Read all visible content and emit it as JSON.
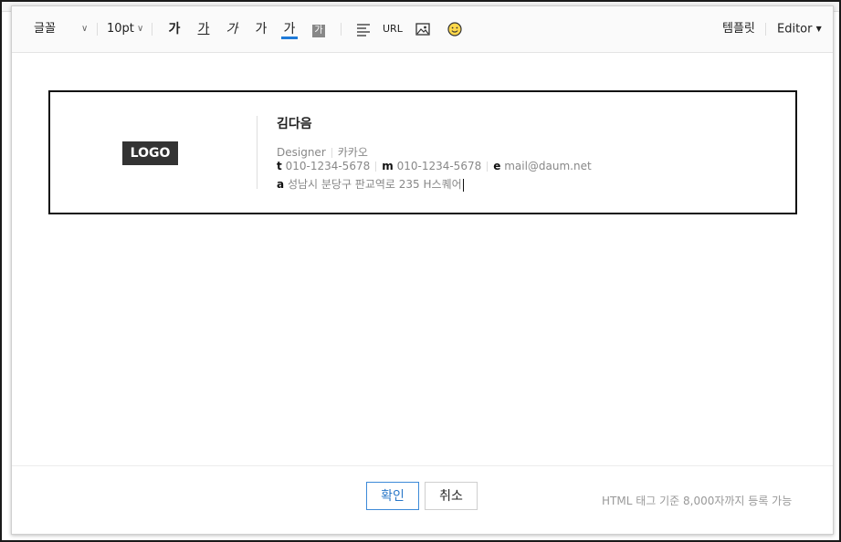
{
  "toolbar": {
    "font_label": "글꼴",
    "font_size": "10pt",
    "format_buttons": {
      "bold": "가",
      "underline": "가",
      "italic": "가",
      "strike": "가",
      "text_color": "가",
      "bg_color": "가"
    },
    "url_label": "URL",
    "template_label": "템플릿",
    "editor_label": "Editor",
    "accent_color": "#1e7ad8"
  },
  "signature": {
    "logo_text": "LOGO",
    "name": "김다음",
    "title": "Designer",
    "company": "카카오",
    "t_label": "t",
    "t_value": "010-1234-5678",
    "m_label": "m",
    "m_value": "010-1234-5678",
    "e_label": "e",
    "e_value": "mail@daum.net",
    "a_label": "a",
    "a_value": "성남시 분당구 판교역로 235 H스퀘어"
  },
  "footer": {
    "confirm_label": "확인",
    "cancel_label": "취소",
    "note": "HTML 태그 기준 8,000자까지 등록 가능"
  }
}
